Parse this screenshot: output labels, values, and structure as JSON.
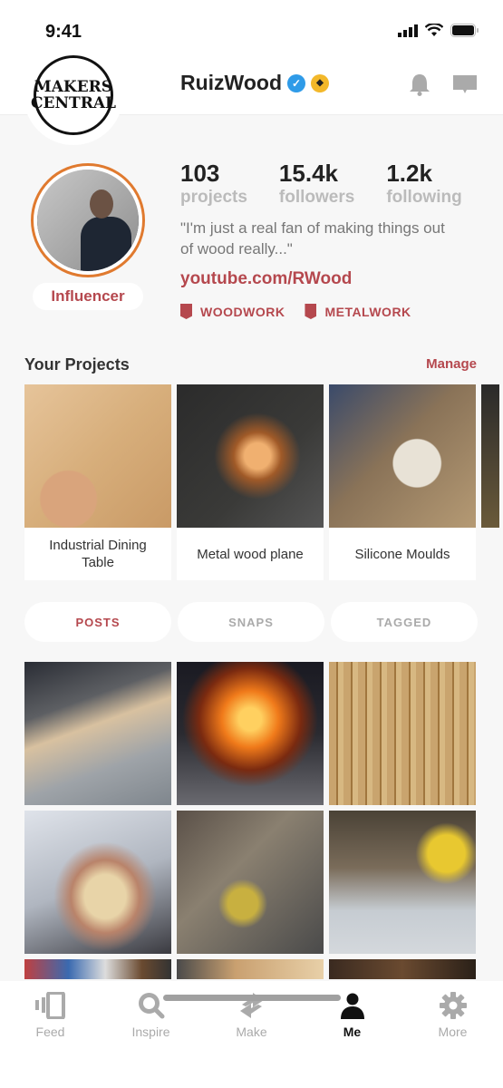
{
  "status_bar": {
    "time": "9:41"
  },
  "header": {
    "logo": {
      "line1": "MAKERS",
      "line2": "CENTRAL"
    },
    "username": "RuizWood",
    "verified_icon": "verified-check-icon",
    "badge_icon": "gold-badge-icon",
    "actions": [
      {
        "name": "notifications",
        "icon": "bell-icon"
      },
      {
        "name": "messages",
        "icon": "chat-icon"
      }
    ]
  },
  "profile": {
    "role": "Influencer",
    "stats": [
      {
        "value": "103",
        "label": "projects"
      },
      {
        "value": "15.4k",
        "label": "followers"
      },
      {
        "value": "1.2k",
        "label": "following"
      }
    ],
    "bio": "\"I'm just a real fan of making things out of wood really...\"",
    "link": "youtube.com/RWood",
    "tags": [
      "WOODWORK",
      "METALWORK"
    ]
  },
  "projects_section": {
    "title": "Your Projects",
    "manage_label": "Manage",
    "items": [
      {
        "label": "Industrial Dining Table",
        "image": "wood chiseling"
      },
      {
        "label": "Metal wood plane",
        "image": "angle grinder sparks"
      },
      {
        "label": "Silicone Moulds",
        "image": "hands measuring at workbench"
      }
    ]
  },
  "tabs": [
    {
      "label": "POSTS",
      "active": true
    },
    {
      "label": "SNAPS",
      "active": false
    },
    {
      "label": "TAGGED",
      "active": false
    }
  ],
  "posts": [
    "table saw cutting wood block",
    "glassblowing torch flame",
    "tool wall with chisels",
    "hand carving wooden spoon",
    "cluttered workshop with grinder",
    "hands assembling on workbench",
    "colorful workshop",
    "wood planks",
    "dark workshop"
  ],
  "bottom_nav": [
    {
      "label": "Feed",
      "icon": "feed-icon",
      "active": false
    },
    {
      "label": "Inspire",
      "icon": "search-icon",
      "active": false
    },
    {
      "label": "Make",
      "icon": "make-arrows-icon",
      "active": false
    },
    {
      "label": "Me",
      "icon": "person-icon",
      "active": true
    },
    {
      "label": "More",
      "icon": "gear-icon",
      "active": false
    }
  ],
  "colors": {
    "accent": "#b5484e",
    "avatar_ring": "#e07a2f",
    "verified": "#2f9be8",
    "badge": "#f3b82a"
  }
}
